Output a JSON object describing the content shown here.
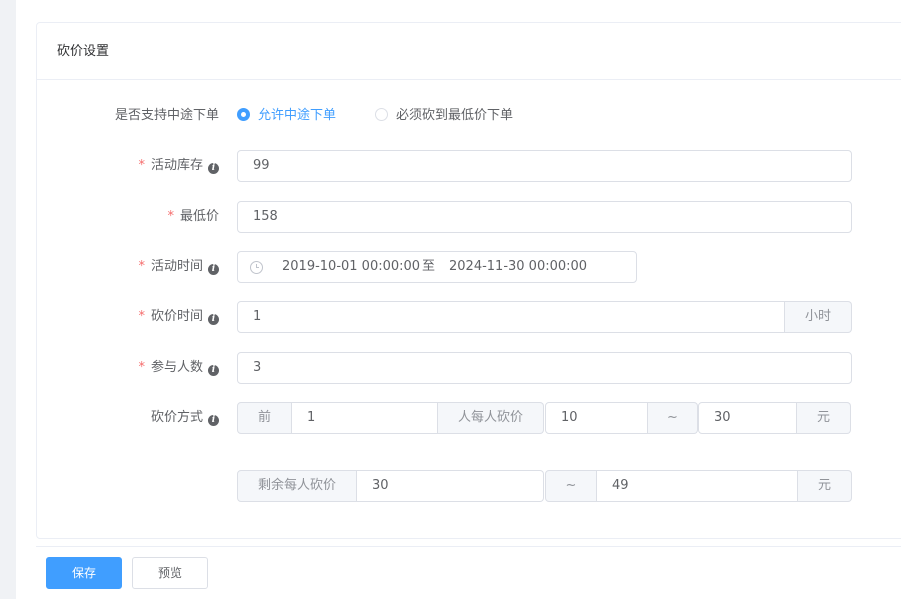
{
  "card": {
    "title": "砍价设置"
  },
  "form": {
    "midway": {
      "label": "是否支持中途下单",
      "options": [
        "允许中途下单",
        "必须砍到最低价下单"
      ],
      "selected": 0
    },
    "stock": {
      "label": "活动库存",
      "value": "99"
    },
    "min_price": {
      "label": "最低价",
      "value": "158"
    },
    "activity_time": {
      "label": "活动时间",
      "start": "2019-10-01 00:00:00",
      "separator": "至",
      "end": "2024-11-30 00:00:00"
    },
    "bargain_time": {
      "label": "砍价时间",
      "value": "1",
      "unit": "小时"
    },
    "participants": {
      "label": "参与人数",
      "value": "3"
    },
    "bargain_method": {
      "label": "砍价方式",
      "prefix": "前",
      "count": "1",
      "per_person_label": "人每人砍价",
      "min": "10",
      "tilde": "~",
      "max": "30",
      "unit": "元",
      "rest_label": "剩余每人砍价",
      "rest_min": "30",
      "rest_max": "49"
    },
    "required_mark": "*",
    "info_glyph": "i"
  },
  "buttons": {
    "save": "保存",
    "preview": "预览"
  },
  "colors": {
    "primary": "#409eff",
    "required": "#f56c6c"
  }
}
